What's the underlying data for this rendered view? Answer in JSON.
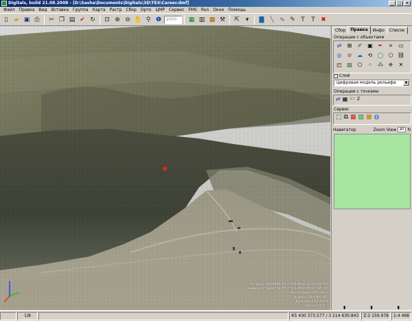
{
  "window": {
    "title": "Digitals, build 21.08.2008 - [D:\\Sasha\\Documents\\Digitals\\3D\\TEX\\Career.dmf]",
    "controls": [
      "_",
      "□",
      "×"
    ]
  },
  "menu": [
    "Файл",
    "Правка",
    "Вид",
    "Вставка",
    "Группа",
    "Карта",
    "Растр",
    "Сбор",
    "Орто",
    "ЦМР",
    "Сервис",
    "FMS",
    "Run",
    "Окно",
    "Помощь"
  ],
  "toolbar": {
    "zoom_placeholder": "2000"
  },
  "panel": {
    "tabs": [
      {
        "label": "Сбор",
        "active": false
      },
      {
        "label": "Правка",
        "active": true
      },
      {
        "label": "Инфо",
        "active": false
      },
      {
        "label": "Список",
        "active": false
      }
    ],
    "object_ops_title": "Операции с объектами",
    "layer_label": "Слой",
    "layer_value": "Цифровая модель рельефа",
    "point_ops_title": "Операции с точками",
    "point_ops_xyz": "XY",
    "point_ops_z": "Z",
    "service_title": "Сервис",
    "navigator_label": "Навигатор",
    "zoom_view_label": "Zoom View",
    "all_label": "All",
    "navigator_bg": "#a6e6a0"
  },
  "view_info": {
    "lines": [
      "Точка X:5429896.83 Y:3214650.42 Z:311.79",
      "Камера X:5429704.65 Y:3214790.86 Z:195.18",
      "Расстояние 265.04 м",
      "Азимут 143°48'16\"",
      "Дальние 182.74 м",
      "Уклон 53.1 °"
    ]
  },
  "statusbar": {
    "page": "1/8",
    "coords": "К5 430 373.577 / 3 214 630.843",
    "z_value": "Z:2 159.978",
    "scale": "1:4 468"
  }
}
